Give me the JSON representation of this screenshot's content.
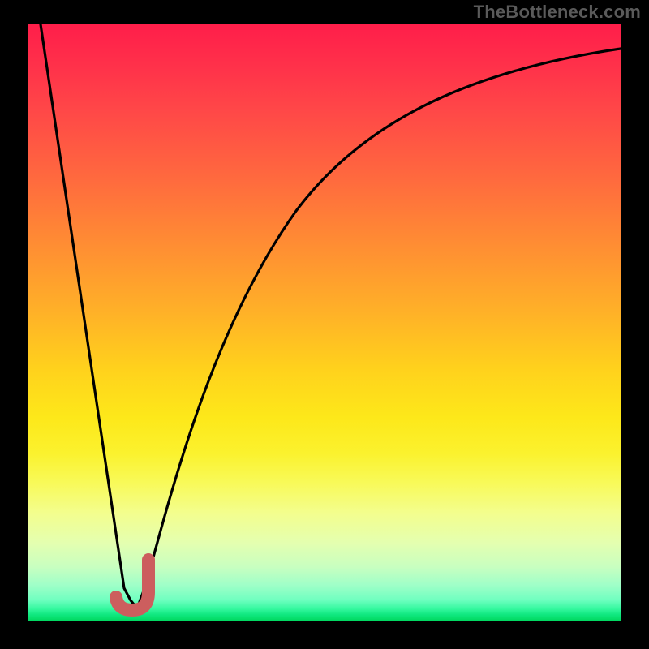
{
  "attribution": "TheBottleneck.com",
  "colors": {
    "frame": "#000000",
    "curve": "#000000",
    "marker": "#cc5e5e",
    "gradient_top": "#ff1e4a",
    "gradient_bottom": "#00d860"
  },
  "chart_data": {
    "type": "line",
    "title": "",
    "xlabel": "",
    "ylabel": "",
    "xlim": [
      0,
      100
    ],
    "ylim": [
      0,
      100
    ],
    "grid": false,
    "legend": false,
    "series": [
      {
        "name": "bottleneck-curve",
        "x": [
          0,
          5,
          10,
          14,
          16,
          18,
          20,
          22,
          25,
          30,
          35,
          40,
          45,
          50,
          55,
          60,
          65,
          70,
          75,
          80,
          85,
          90,
          95,
          100
        ],
        "y": [
          100,
          70,
          40,
          12,
          2,
          0.5,
          3,
          12,
          30,
          52,
          65,
          73,
          79,
          83,
          86,
          88.5,
          90.5,
          92,
          93,
          93.8,
          94.5,
          95,
          95.5,
          95.8
        ]
      }
    ],
    "annotations": [
      {
        "name": "optimal-j-marker",
        "type": "glyph",
        "glyph": "J",
        "x": 18,
        "y": 3,
        "color": "#cc5e5e"
      }
    ],
    "background": {
      "type": "vertical-heat-gradient",
      "description": "green (good) at bottom through yellow/orange to red (bad) at top"
    }
  }
}
